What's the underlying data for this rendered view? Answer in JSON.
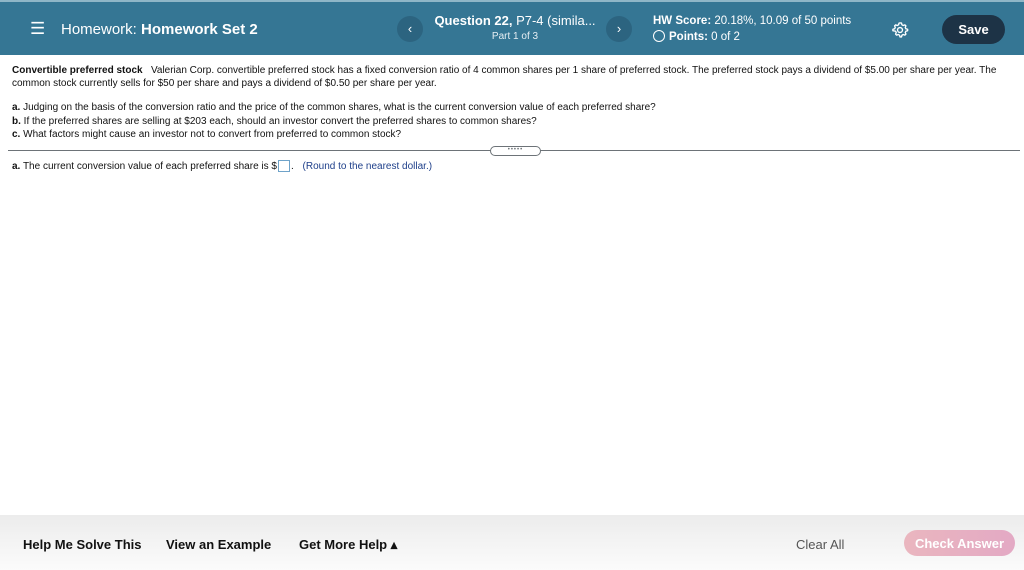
{
  "header": {
    "menu_icon": "hamburger-menu-icon",
    "homework_label": "Homework:",
    "homework_name": "Homework Set 2",
    "prev_icon": "‹",
    "next_icon": "›",
    "question_bold": "Question 22,",
    "question_rest": " P7-4 (simila...",
    "part": "Part 1 of 3",
    "hw_score_label": "HW Score:",
    "hw_score_value": " 20.18%, 10.09 of 50 points",
    "points_label": "Points:",
    "points_value": " 0 of 2",
    "settings_icon": "gear-icon",
    "save_label": "Save"
  },
  "problem": {
    "title": "Convertible preferred stock",
    "text": "Valerian Corp. convertible preferred stock has a fixed conversion ratio of 4 common shares per 1 share of preferred stock.  The preferred stock pays a dividend of $5.00 per share per year.  The common stock currently sells for $50 per share and pays a dividend of $0.50 per share per year.",
    "parts": [
      {
        "letter": "a.",
        "text": "Judging on the basis of the conversion ratio and the price of the common shares, what is the current conversion value of each preferred share?"
      },
      {
        "letter": "b.",
        "text": "If the preferred shares are selling at $203 each, should an investor convert the preferred shares to common shares?"
      },
      {
        "letter": "c.",
        "text": "What factors might cause an investor not to convert from preferred to common stock?"
      }
    ],
    "expander": "•••••"
  },
  "answer": {
    "letter": "a.",
    "prefix": "The current conversion value of each preferred share is $",
    "value": "",
    "suffix": ".",
    "hint": "(Round to the nearest dollar.)"
  },
  "footer": {
    "help_me_solve": "Help Me Solve This",
    "view_example": "View an Example",
    "get_more_help": "Get More Help ▴",
    "clear_all": "Clear All",
    "check_answer": "Check Answer"
  }
}
